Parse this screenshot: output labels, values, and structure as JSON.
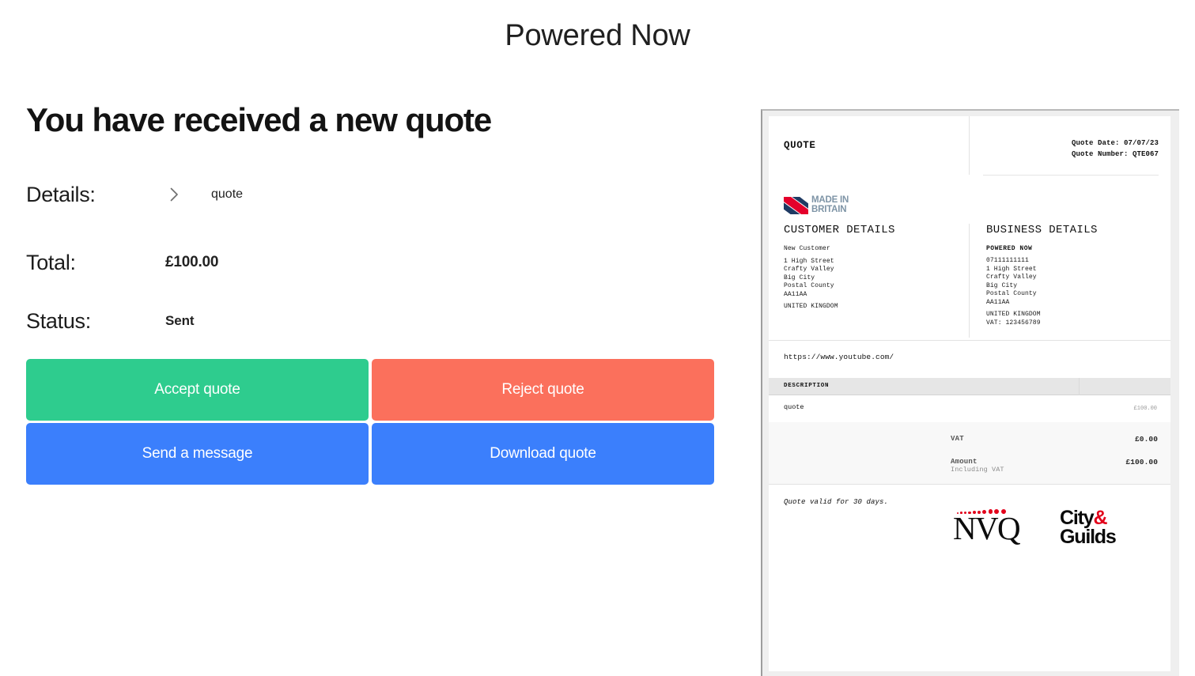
{
  "header": {
    "title": "Powered Now"
  },
  "main": {
    "heading": "You have received a new quote",
    "details": {
      "label": "Details:",
      "expander_icon": "chevron-right-icon",
      "value": "quote"
    },
    "total": {
      "label": "Total:",
      "value": "£100.00"
    },
    "status": {
      "label": "Status:",
      "value": "Sent"
    },
    "actions": [
      {
        "id": "accept-quote",
        "label": "Accept quote",
        "color": "#2ecc8e"
      },
      {
        "id": "reject-quote",
        "label": "Reject quote",
        "color": "#fb705c"
      },
      {
        "id": "send-message",
        "label": "Send a message",
        "color": "#3b7ffc"
      },
      {
        "id": "download-quote",
        "label": "Download quote",
        "color": "#3b7ffc"
      }
    ]
  },
  "document": {
    "doc_type": "QUOTE",
    "meta": {
      "date": "Quote Date: 07/07/23",
      "number": "Quote Number: QTE067"
    },
    "accreditation_logo": {
      "icon": "made-in-britain-logo",
      "line1": "MADE IN",
      "line2": "BRITAIN"
    },
    "customer": {
      "heading": "CUSTOMER DETAILS",
      "name": "New Customer",
      "address": [
        "1 High Street",
        "Crafty Valley",
        "Big City",
        "Postal County",
        "AA11AA"
      ],
      "country": "UNITED KINGDOM"
    },
    "business": {
      "heading": "BUSINESS DETAILS",
      "name": "POWERED NOW",
      "phone": "07111111111",
      "address": [
        "1 High Street",
        "Crafty Valley",
        "Big City",
        "Postal County",
        "AA11AA"
      ],
      "country": "UNITED KINGDOM",
      "vat": "VAT: 123456789"
    },
    "url": "https://www.youtube.com/",
    "table": {
      "header": "DESCRIPTION",
      "rows": [
        {
          "description": "quote",
          "amount": "£100.00"
        }
      ]
    },
    "totals": [
      {
        "key": "VAT",
        "sub": "",
        "value": "£0.00"
      },
      {
        "key": "Amount",
        "sub": "Including VAT",
        "value": "£100.00"
      }
    ],
    "footnote": "Quote valid for 30 days.",
    "certifications": [
      {
        "icon": "nvq-logo",
        "label": "NVQ"
      },
      {
        "icon": "city-and-guilds-logo",
        "label_line1": "City&",
        "label_line2": "Guilds"
      }
    ]
  }
}
